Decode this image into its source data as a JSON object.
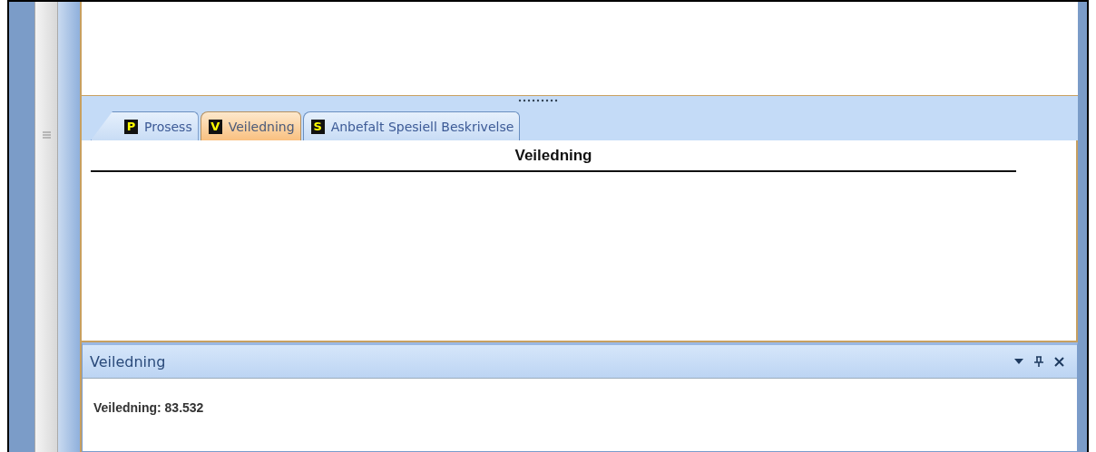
{
  "tabs": [
    {
      "letter": "P",
      "label": "Prosess",
      "selected": false
    },
    {
      "letter": "V",
      "label": "Veiledning",
      "selected": true
    },
    {
      "letter": "S",
      "label": "Anbefalt Spesiell Beskrivelse",
      "selected": false
    }
  ],
  "document": {
    "heading": "Veiledning"
  },
  "panel": {
    "title": "Veiledning",
    "text": "Veiledning: 83.532"
  }
}
